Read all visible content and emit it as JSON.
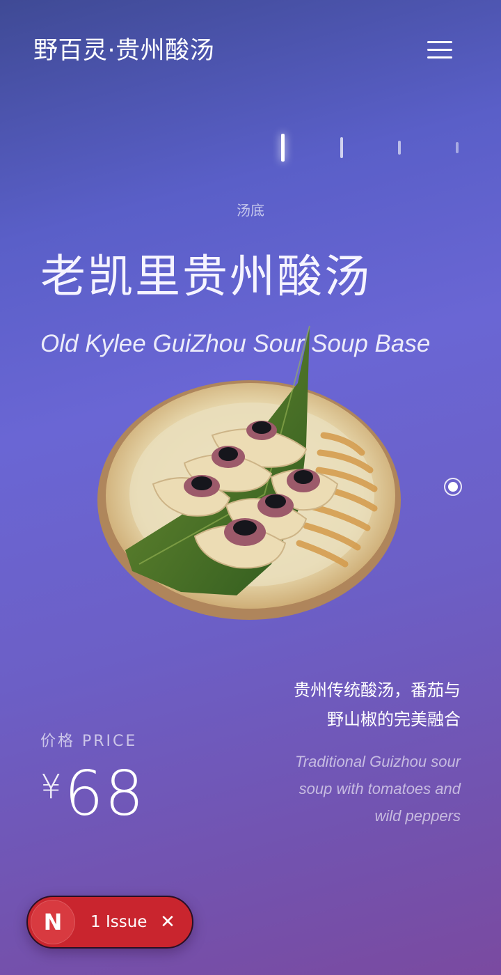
{
  "header": {
    "brand": "野百灵·贵州酸汤",
    "menu_icon": "hamburger-menu-icon"
  },
  "pager": {
    "count": 4,
    "active_index": 0
  },
  "dish": {
    "category": "汤底",
    "name_zh": "老凯里贵州酸汤",
    "name_en": "Old Kylee GuiZhou Sour Soup Base",
    "price_label": "价格 PRICE",
    "currency": "¥",
    "price": "68",
    "description_zh_line1": "贵州传统酸汤，番茄与",
    "description_zh_line2": "野山椒的完美融合",
    "description_en_line1": "Traditional Guizhou sour",
    "description_en_line2": "soup with tomatoes and",
    "description_en_line3": "wild peppers"
  },
  "dev_overlay": {
    "badge_letter": "N",
    "issues_label": "1 Issue",
    "close_icon": "close-icon"
  },
  "colors": {
    "background_top": "#3f4a95",
    "background_mid": "#6a66d4",
    "background_bottom": "#7a4aa0",
    "issue_pill": "#c9252e"
  }
}
